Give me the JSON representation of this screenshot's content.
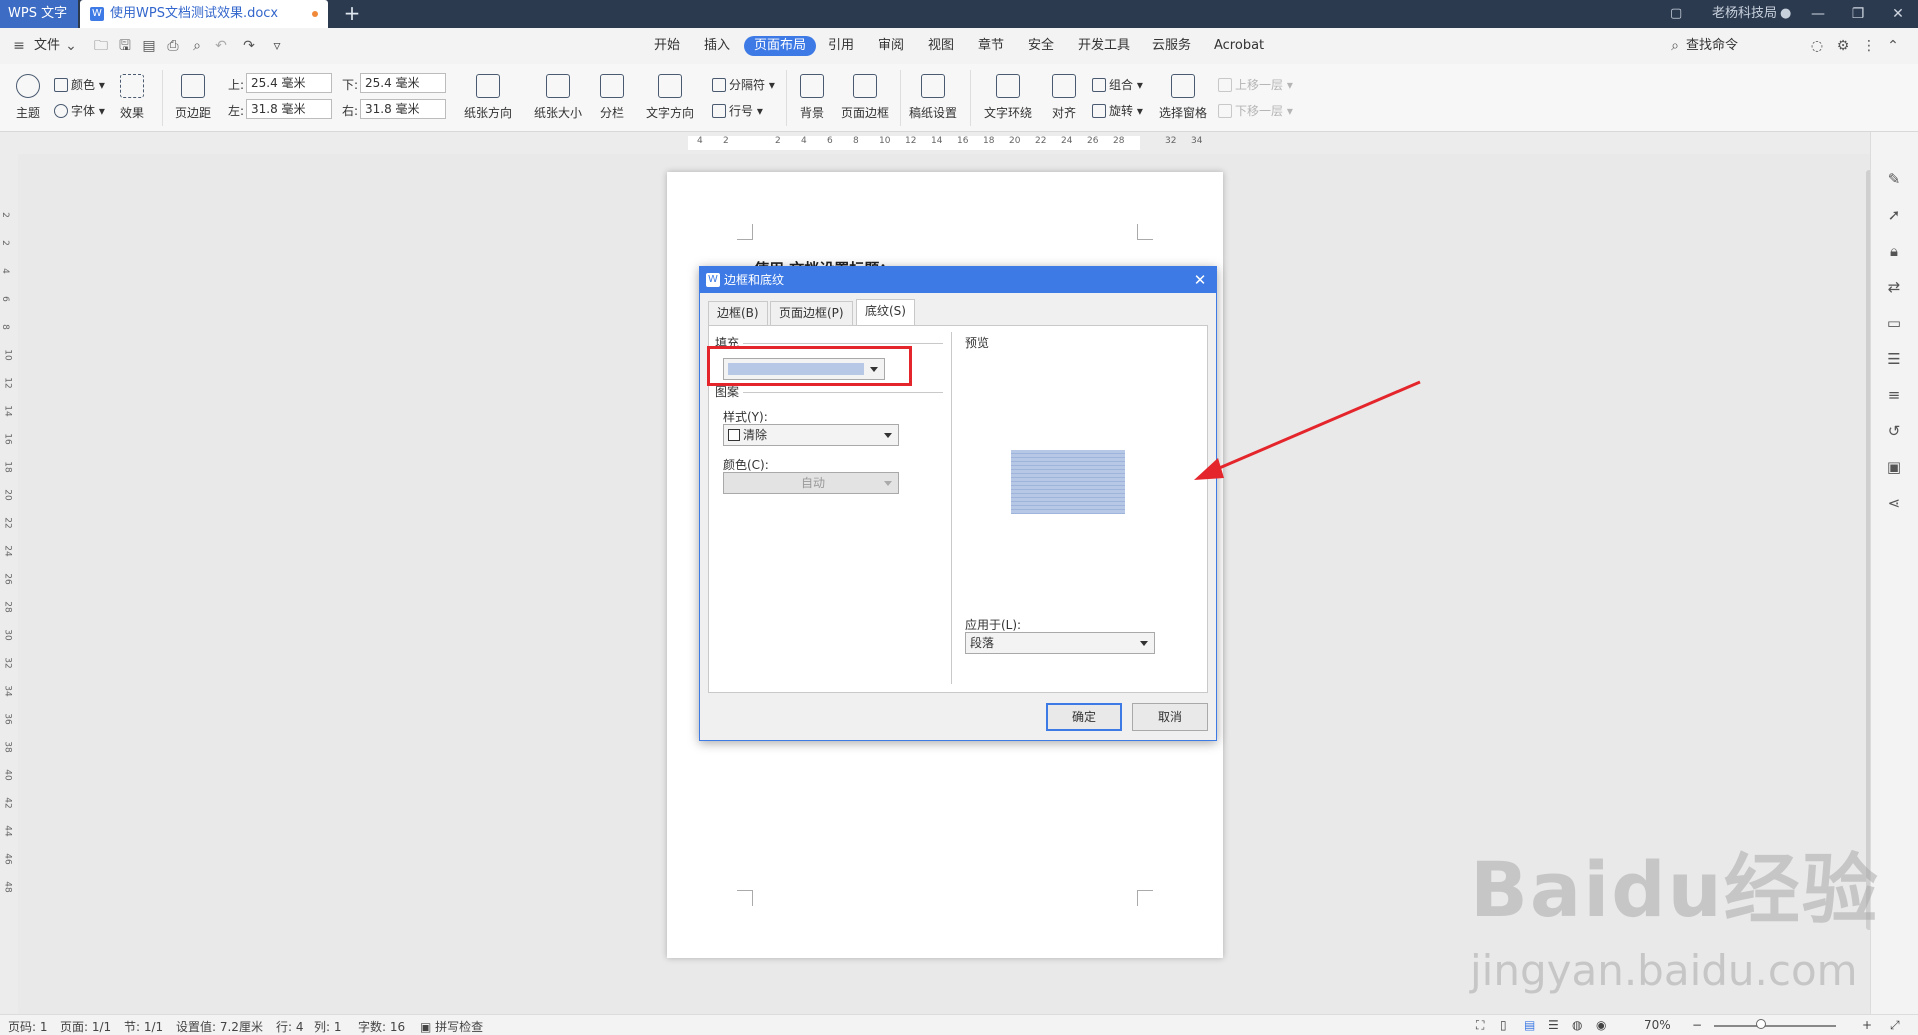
{
  "titlebar": {
    "app_tab": "WPS 文字",
    "doc_tab": "使用WPS文档测试效果.docx",
    "new_tab": "+",
    "user": "老杨科技局"
  },
  "menu": {
    "file": "文件",
    "items": [
      "开始",
      "插入",
      "页面布局",
      "引用",
      "审阅",
      "视图",
      "章节",
      "安全",
      "开发工具",
      "云服务",
      "Acrobat"
    ],
    "active": "页面布局",
    "search": "查找命令"
  },
  "ribbon": {
    "theme": "主题",
    "colors": "颜色",
    "fonts": "字体",
    "effects": "效果",
    "margins": "页边距",
    "top_label": "上:",
    "top_value": "25.4 毫米",
    "bottom_label": "下:",
    "bottom_value": "25.4 毫米",
    "left_label": "左:",
    "left_value": "31.8 毫米",
    "right_label": "右:",
    "right_value": "31.8 毫米",
    "orientation": "纸张方向",
    "size": "纸张大小",
    "columns": "分栏",
    "text_direction": "文字方向",
    "breaks": "分隔符",
    "line_numbers": "行号",
    "background": "背景",
    "page_border": "页面边框",
    "manuscript": "稿纸设置",
    "wrap": "文字环绕",
    "align": "对齐",
    "group": "组合",
    "rotate": "旋转",
    "selection_pane": "选择窗格",
    "bring_forward": "上移一层",
    "send_backward": "下移一层"
  },
  "ruler": {
    "h_ticks": [
      "4",
      "2",
      "2",
      "4",
      "6",
      "8",
      "10",
      "12",
      "14",
      "16",
      "18",
      "20",
      "22",
      "24",
      "26",
      "28",
      "32",
      "34"
    ],
    "v_ticks": [
      "2",
      "2",
      "4",
      "6",
      "8",
      "10",
      "12",
      "14",
      "16",
      "18",
      "20",
      "22",
      "24",
      "26",
      "28",
      "30",
      "32",
      "34",
      "36",
      "38",
      "40",
      "42",
      "44",
      "46",
      "48"
    ]
  },
  "document": {
    "heading_partial": "使用     文档设置标题："
  },
  "dialog": {
    "title": "边框和底纹",
    "tabs": [
      "边框(B)",
      "页面边框(P)",
      "底纹(S)"
    ],
    "active_tab": "底纹(S)",
    "fill_label": "填充",
    "fill_color": "#b7c8e6",
    "pattern_label": "图案",
    "style_label": "样式(Y):",
    "style_value": "清除",
    "color_label": "颜色(C):",
    "color_value": "自动",
    "preview_label": "预览",
    "apply_label": "应用于(L):",
    "apply_value": "段落",
    "ok": "确定",
    "cancel": "取消"
  },
  "status": {
    "page_num": "页码: 1",
    "pages": "页面: 1/1",
    "section": "节: 1/1",
    "setting": "设置值: 7.2厘米",
    "row": "行: 4",
    "col": "列: 1",
    "words": "字数: 16",
    "spellcheck": "拼写检查",
    "zoom": "70%"
  },
  "watermark": {
    "logo": "Baidu经验",
    "url": "jingyan.baidu.com"
  },
  "colors": {
    "accent": "#3d7ae5",
    "annotation": "#e4262c"
  }
}
